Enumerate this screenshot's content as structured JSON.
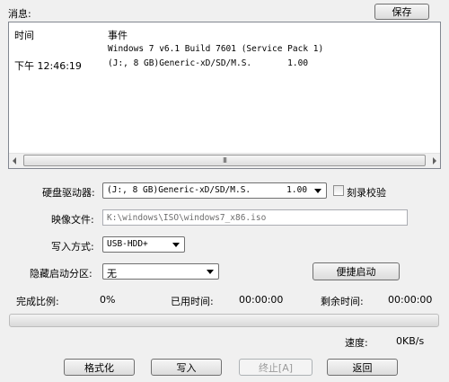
{
  "messages": {
    "label": "消息:",
    "save_label": "保存",
    "columns": {
      "time": "时间",
      "event": "事件"
    },
    "line1": "Windows 7 v6.1 Build 7601 (Service Pack 1)",
    "line2_time": "下午 12:46:19",
    "line2_event": "(J:, 8 GB)Generic-xD/SD/M.S.       1.00",
    "scroll_thumb": "III"
  },
  "drive": {
    "label": "硬盘驱动器:",
    "value": "(J:, 8 GB)Generic-xD/SD/M.S.       1.00",
    "verify_label": "刻录校验",
    "verify_checked": false
  },
  "image": {
    "label": "映像文件:",
    "value": "K:\\windows\\ISO\\windows7_x86.iso"
  },
  "write_mode": {
    "label": "写入方式:",
    "value": "USB-HDD+"
  },
  "hidden_partition": {
    "label": "隐藏启动分区:",
    "value": "无",
    "quick_boot_label": "便捷启动"
  },
  "status": {
    "complete_label": "完成比例:",
    "complete_value": "0%",
    "elapsed_label": "已用时间:",
    "elapsed_value": "00:00:00",
    "remaining_label": "剩余时间:",
    "remaining_value": "00:00:00",
    "speed_label": "速度:",
    "speed_value": "0KB/s",
    "progress_fraction": 0
  },
  "buttons": {
    "format": "格式化",
    "write": "写入",
    "abort": "终止[A]",
    "back": "返回"
  }
}
